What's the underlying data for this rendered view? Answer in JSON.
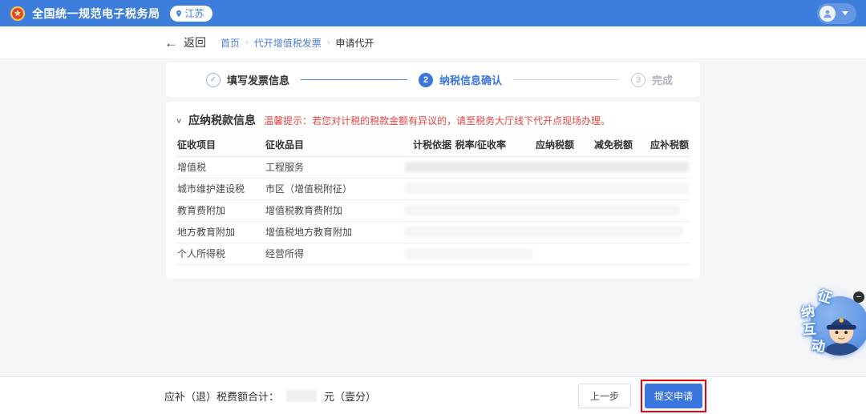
{
  "header": {
    "title": "全国统一规范电子税务局",
    "region": "江苏"
  },
  "breadcrumb": {
    "back_label": "返回",
    "items": [
      {
        "label": "首页"
      },
      {
        "label": "代开增值税发票"
      },
      {
        "label": "申请代开"
      }
    ]
  },
  "stepper": {
    "steps": [
      {
        "number": "1",
        "label": "填写发票信息",
        "state": "completed"
      },
      {
        "number": "2",
        "label": "纳税信息确认",
        "state": "active"
      },
      {
        "number": "3",
        "label": "完成",
        "state": "pending"
      }
    ]
  },
  "section": {
    "title": "应纳税款信息",
    "warning": "温馨提示：若您对计税的税款金额有异议的，请至税务大厅线下代开点现场办理。"
  },
  "table": {
    "headers": [
      "征收项目",
      "征收品目",
      "计税依据",
      "税率/征收率",
      "应纳税额",
      "减免税额",
      "应补税额"
    ],
    "rows": [
      {
        "item": "增值税",
        "category": "工程服务"
      },
      {
        "item": "城市维护建设税",
        "category": "市区（增值税附征）"
      },
      {
        "item": "教育费附加",
        "category": "增值税教育费附加"
      },
      {
        "item": "地方教育附加",
        "category": "增值税地方教育附加"
      },
      {
        "item": "个人所得税",
        "category": "经营所得"
      }
    ],
    "values_redacted": true
  },
  "footer": {
    "total_label": "应补（退）税费额合计：",
    "total_unit": "元（壹分）",
    "prev_button": "上一步",
    "submit_button": "提交申请"
  },
  "float_widget": {
    "chars": [
      "征",
      "纳",
      "互",
      "动"
    ]
  },
  "icons": {
    "check": "✓",
    "collapse_caret": "∨",
    "back_arrow": "←",
    "breadcrumb_separator": "›",
    "minus": "−"
  },
  "colors": {
    "header_bg": "#3d7edc",
    "primary_blue": "#3a76dd",
    "warning_red": "#e64242",
    "annotation_red": "#e60012"
  }
}
